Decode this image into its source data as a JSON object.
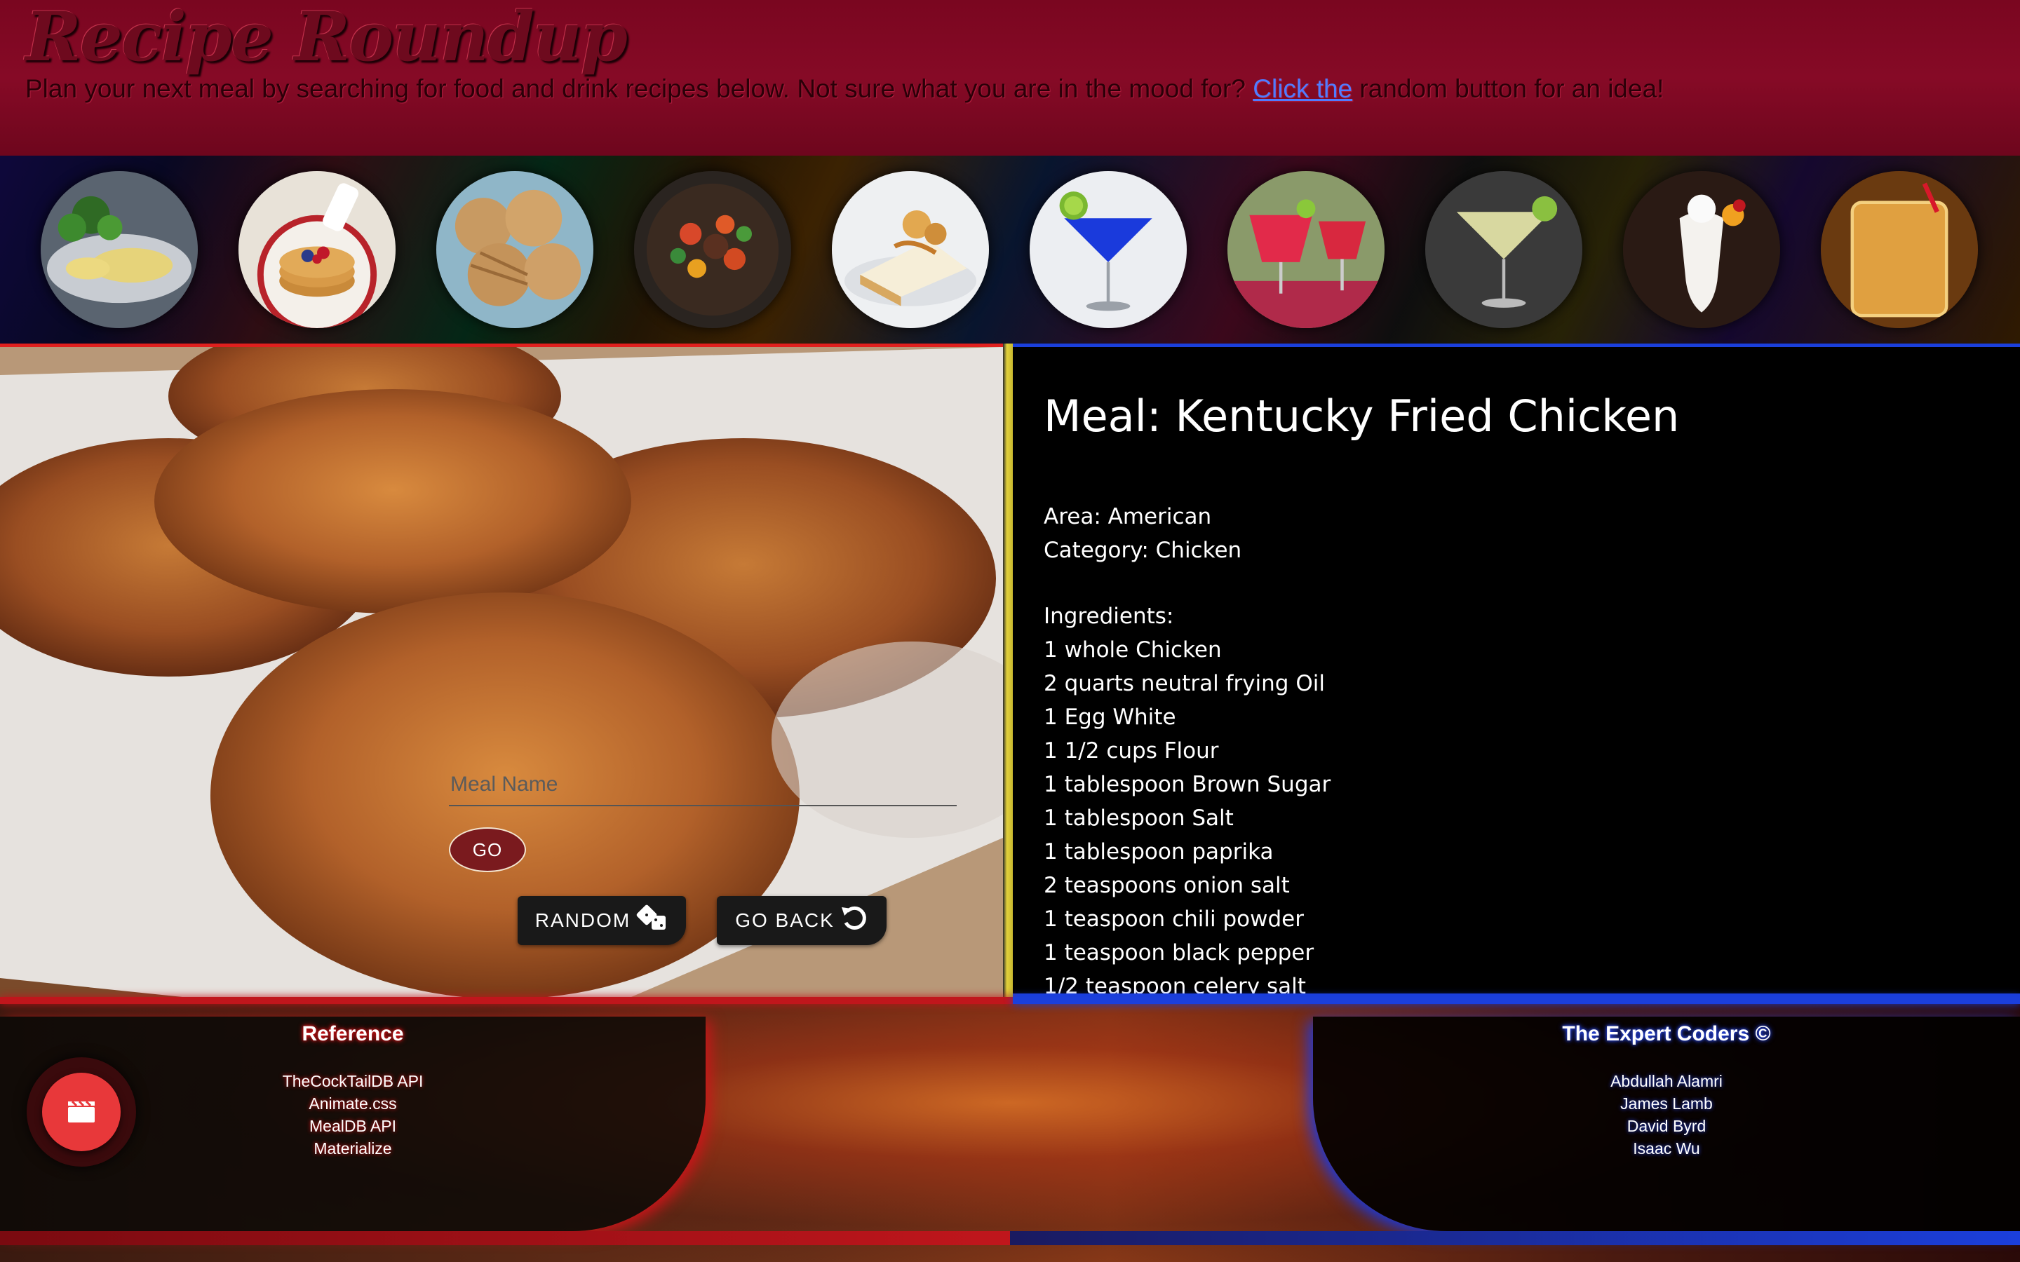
{
  "header": {
    "title": "Recipe Roundup",
    "tagline_before": "Plan your next meal by searching for food and drink recipes below. Not sure what you are in the mood for? ",
    "tagline_link": "Click the",
    "tagline_after": " random button for an idea!"
  },
  "carousel": {
    "items": [
      {
        "icon": "omelette-thumbnail"
      },
      {
        "icon": "pancakes-thumbnail"
      },
      {
        "icon": "cookies-thumbnail"
      },
      {
        "icon": "stew-thumbnail"
      },
      {
        "icon": "cheesecake-thumbnail"
      },
      {
        "icon": "blue-martini-thumbnail"
      },
      {
        "icon": "red-margarita-thumbnail"
      },
      {
        "icon": "lime-martini-thumbnail"
      },
      {
        "icon": "pina-colada-thumbnail"
      },
      {
        "icon": "orange-cocktail-thumbnail"
      }
    ]
  },
  "search": {
    "placeholder": "Meal Name",
    "go_label": "GO",
    "random_label": "RANDOM",
    "random_icon": "dice-icon",
    "back_label": "GO BACK",
    "back_icon": "undo-icon"
  },
  "recipe": {
    "title": "Meal: Kentucky Fried Chicken",
    "area": "Area: American",
    "category": "Category: Chicken",
    "ingredients_label": "Ingredients:",
    "ingredients": [
      "1 whole Chicken",
      "2 quarts neutral frying Oil",
      "1 Egg White",
      "1 1/2 cups Flour",
      "1 tablespoon Brown Sugar",
      "1 tablespoon Salt",
      "1 tablespoon paprika",
      "2 teaspoons onion salt",
      "1 teaspoon chili powder",
      "1 teaspoon black pepper",
      "1/2 teaspoon celery salt"
    ]
  },
  "footer": {
    "reference": {
      "heading": "Reference",
      "links": [
        "TheCockTailDB API",
        "Animate.css",
        "MealDB API",
        "Materialize"
      ]
    },
    "team": {
      "heading": "The Expert Coders ©",
      "members": [
        "Abdullah Alamri",
        "James Lamb",
        "David Byrd",
        "Isaac Wu"
      ]
    },
    "fab_icon": "clapperboard-icon"
  },
  "colors": {
    "header_red": "#860a26",
    "accent_red": "#e0201e",
    "accent_blue": "#1b3fdc",
    "accent_yellow": "#e2d13a",
    "link_blue": "#4f7cff",
    "fab_red": "#e8383a"
  }
}
